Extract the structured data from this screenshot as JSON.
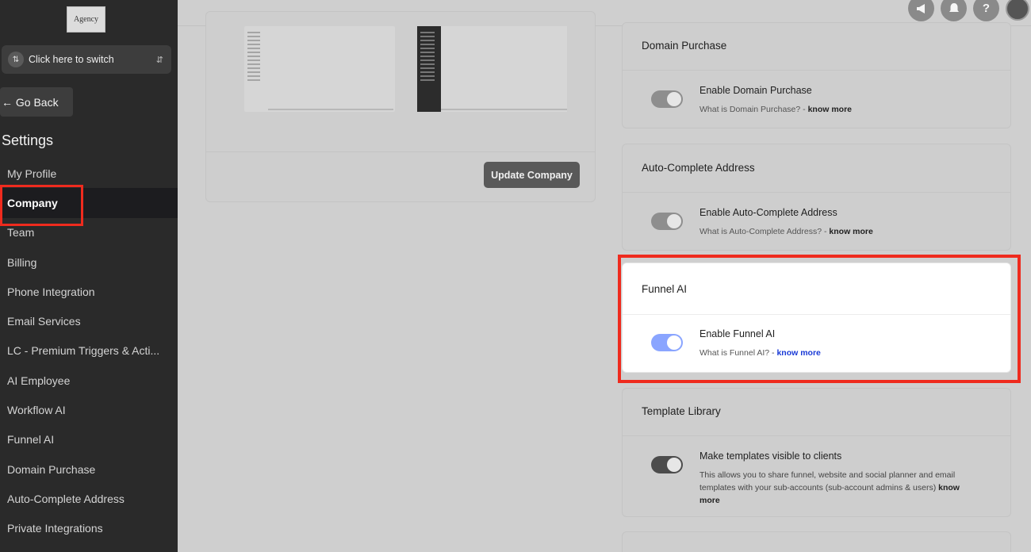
{
  "sidebar": {
    "logo_text": "Agency",
    "switcher_label": "Click here to switch",
    "go_back": "← Go Back",
    "section_title": "Settings",
    "items": [
      {
        "label": "My Profile"
      },
      {
        "label": "Company"
      },
      {
        "label": "Team"
      },
      {
        "label": "Billing"
      },
      {
        "label": "Phone Integration"
      },
      {
        "label": "Email Services"
      },
      {
        "label": "LC - Premium Triggers & Acti..."
      },
      {
        "label": "AI Employee"
      },
      {
        "label": "Workflow AI"
      },
      {
        "label": "Funnel AI"
      },
      {
        "label": "Domain Purchase"
      },
      {
        "label": "Auto-Complete Address"
      },
      {
        "label": "Private Integrations"
      }
    ],
    "active_item": "Company"
  },
  "topbar": {
    "icons": [
      "megaphone-icon",
      "bell-icon",
      "help-icon",
      "avatar"
    ],
    "help_glyph": "?"
  },
  "company_panel": {
    "update_button": "Update Company"
  },
  "cards": {
    "domain_purchase": {
      "title": "Domain Purchase",
      "toggle_label": "Enable Domain Purchase",
      "help_text": "What is Domain Purchase? - ",
      "know_more": "know more",
      "enabled": true
    },
    "auto_complete": {
      "title": "Auto-Complete Address",
      "toggle_label": "Enable Auto-Complete Address",
      "help_text": "What is Auto-Complete Address? - ",
      "know_more": "know more",
      "enabled": true
    },
    "funnel_ai": {
      "title": "Funnel AI",
      "toggle_label": "Enable Funnel AI",
      "help_text": "What is Funnel AI? - ",
      "know_more": "know more",
      "enabled": true
    },
    "template_library": {
      "title": "Template Library",
      "toggle_label": "Make templates visible to clients",
      "description": "This allows you to share funnel, website and social planner and email templates with your sub-accounts (sub-account admins & users) ",
      "know_more": "know more",
      "enabled": true
    }
  },
  "colors": {
    "sidebar_bg": "#2a2a2a",
    "highlight_red": "#ef2b1e",
    "toggle_blue": "#8aa5ff",
    "link_blue": "#1a3ad6"
  }
}
